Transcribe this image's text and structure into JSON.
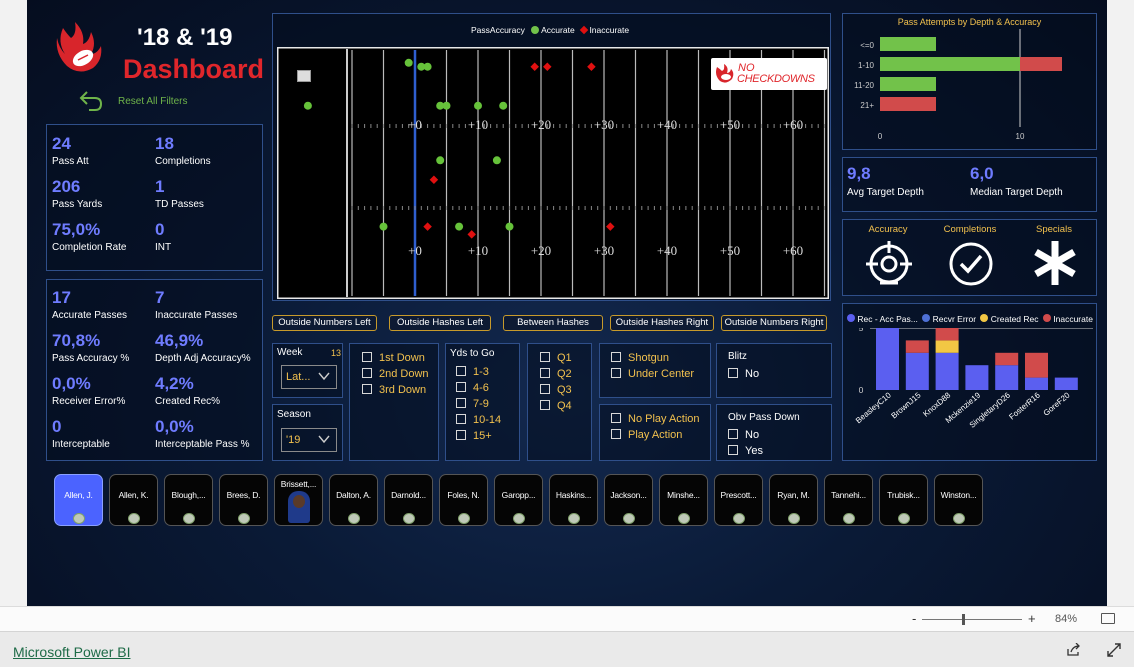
{
  "header": {
    "title_line1": "'18 & '19",
    "title_line2": "Dashboard",
    "reset": "Reset All Filters"
  },
  "kpis1": [
    {
      "v": "24",
      "l": "Pass Att"
    },
    {
      "v": "18",
      "l": "Completions"
    },
    {
      "v": "206",
      "l": "Pass Yards"
    },
    {
      "v": "1",
      "l": "TD Passes"
    },
    {
      "v": "75,0%",
      "l": "Completion Rate"
    },
    {
      "v": "0",
      "l": "INT"
    }
  ],
  "kpis2": [
    {
      "v": "17",
      "l": "Accurate Passes"
    },
    {
      "v": "7",
      "l": "Inaccurate Passes"
    },
    {
      "v": "70,8%",
      "l": "Pass Accuracy %"
    },
    {
      "v": "46,9%",
      "l": "Depth Adj Accuracy%"
    },
    {
      "v": "0,0%",
      "l": "Receiver Error%"
    },
    {
      "v": "4,2%",
      "l": "Created Rec%"
    },
    {
      "v": "0",
      "l": "Interceptable"
    },
    {
      "v": "0,0%",
      "l": "Interceptable Pass %"
    }
  ],
  "field": {
    "legend_title": "PassAccuracy",
    "legend_accurate": "Accurate",
    "legend_inaccurate": "Inaccurate",
    "yard_labels": [
      "+0",
      "+10",
      "+20",
      "+30",
      "+40",
      "+50",
      "+60"
    ],
    "logo_line1": "NO",
    "logo_line2": "CHECKDOWNS",
    "accurate_points": [
      [
        -1,
        28
      ],
      [
        1,
        27
      ],
      [
        2,
        27
      ],
      [
        -17,
        17
      ],
      [
        4,
        17
      ],
      [
        5,
        17
      ],
      [
        10,
        17
      ],
      [
        14,
        17
      ],
      [
        4,
        3
      ],
      [
        13,
        3
      ],
      [
        -5,
        -14
      ],
      [
        7,
        -14
      ],
      [
        15,
        -14
      ]
    ],
    "inaccurate_points": [
      [
        19,
        27
      ],
      [
        21,
        27
      ],
      [
        28,
        27
      ],
      [
        3,
        -2
      ],
      [
        2,
        -14
      ],
      [
        9,
        -16
      ],
      [
        31,
        -14
      ]
    ]
  },
  "zones": [
    "Outside Numbers Left",
    "Outside Hashes Left",
    "Between Hashes",
    "Outside Hashes Right",
    "Outside Numbers Right"
  ],
  "filters": {
    "week_label": "Week",
    "week_count": "13",
    "week_value": "Lat...",
    "season_label": "Season",
    "season_value": "'19",
    "downs": [
      "1st Down",
      "2nd Down",
      "3rd Down"
    ],
    "yds_title": "Yds to Go",
    "yds": [
      "1-3",
      "4-6",
      "7-9",
      "10-14",
      "15+"
    ],
    "quarters": [
      "Q1",
      "Q2",
      "Q3",
      "Q4"
    ],
    "formation": [
      "Shotgun",
      "Under Center"
    ],
    "blitz_title": "Blitz",
    "blitz": [
      "No"
    ],
    "playaction": [
      "No Play Action",
      "Play Action"
    ],
    "obv_title": "Obv Pass Down",
    "obv": [
      "No",
      "Yes"
    ]
  },
  "depth_chart": {
    "title": "Pass Attempts by Depth & Accuracy",
    "categories": [
      "<=0",
      "1-10",
      "11-20",
      "21+"
    ],
    "series": [
      {
        "name": "Accurate",
        "color": "#72c24a",
        "values": [
          4,
          10,
          4,
          0
        ]
      },
      {
        "name": "Inaccurate",
        "color": "#d14b4b",
        "values": [
          0,
          3,
          0,
          4
        ]
      }
    ],
    "ticks": [
      "0",
      "10"
    ]
  },
  "target": {
    "avg_val": "9,8",
    "avg_lbl": "Avg Target Depth",
    "med_val": "6,0",
    "med_lbl": "Median Target Depth"
  },
  "icons": {
    "accuracy": "Accuracy",
    "completions": "Completions",
    "specials": "Specials"
  },
  "rec_chart": {
    "type": "bar",
    "legend": [
      "Rec - Acc Pas...",
      "Recvr Error",
      "Created Rec",
      "Inaccurate"
    ],
    "colors": [
      "#5b5ff0",
      "#4e70d6",
      "#f2c744",
      "#d14b4b"
    ],
    "categories": [
      "BeasleyC10",
      "BrownJ15",
      "KnoxD88",
      "Mckenzie19",
      "SingletaryD26",
      "FosterR16",
      "GoreF20"
    ],
    "series": [
      {
        "name": "Rec - Acc Pas...",
        "values": [
          5,
          3,
          3,
          2,
          2,
          1,
          1
        ]
      },
      {
        "name": "Recvr Error",
        "values": [
          0,
          0,
          0,
          0,
          0,
          0,
          0
        ]
      },
      {
        "name": "Created Rec",
        "values": [
          0,
          0,
          1,
          0,
          0,
          0,
          0
        ]
      },
      {
        "name": "Inaccurate",
        "values": [
          1,
          1,
          2,
          0,
          1,
          2,
          0
        ]
      }
    ],
    "ticks": [
      "0",
      "5"
    ]
  },
  "players": [
    "Allen, J.",
    "Allen, K.",
    "Blough,...",
    "Brees, D.",
    "Brissett,...",
    "Dalton, A.",
    "Darnold...",
    "Foles, N.",
    "Garopp...",
    "Haskins...",
    "Jackson...",
    "Minshe...",
    "Prescott...",
    "Ryan, M.",
    "Tannehi...",
    "Trubisk...",
    "Winston..."
  ],
  "statusbar": {
    "zoom": "84%",
    "minus": "-",
    "plus": "+"
  },
  "footer": {
    "link": "Microsoft Power BI"
  }
}
